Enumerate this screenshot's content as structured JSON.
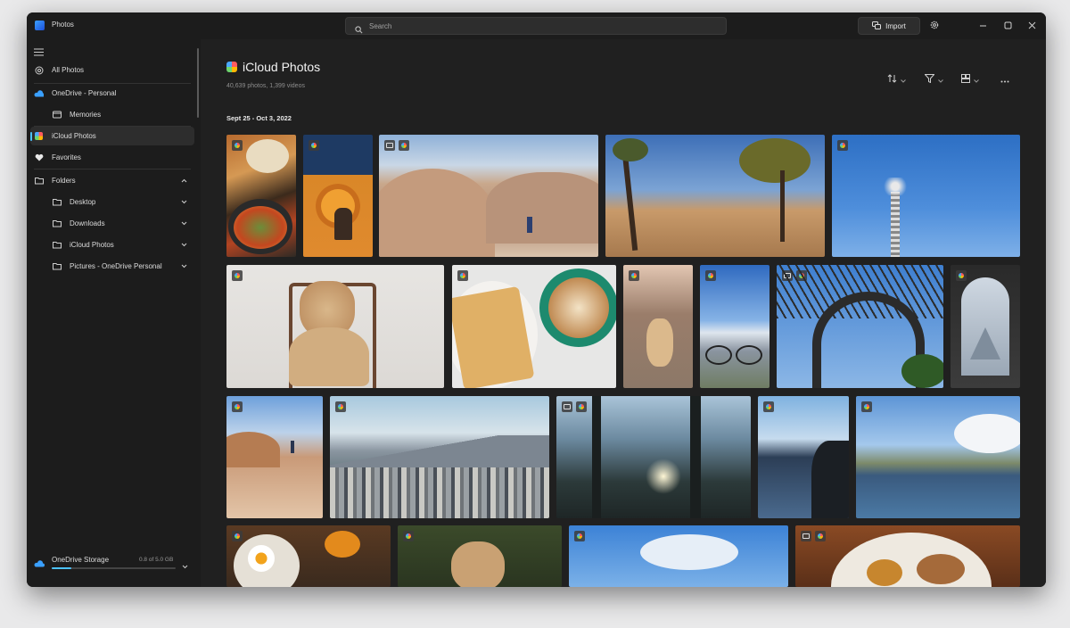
{
  "window": {
    "title": "Photos"
  },
  "search": {
    "placeholder": "Search"
  },
  "toolbar": {
    "import_label": "Import"
  },
  "sidebar": {
    "items": [
      {
        "label": "All Photos",
        "icon": "all-photos-icon"
      },
      {
        "label": "OneDrive - Personal",
        "icon": "onedrive-cloud-icon"
      },
      {
        "label": "Memories",
        "icon": "memories-icon"
      },
      {
        "label": "iCloud Photos",
        "icon": "icloud-photos-icon",
        "selected": true
      },
      {
        "label": "Favorites",
        "icon": "heart-icon"
      },
      {
        "label": "Folders",
        "icon": "folder-icon"
      },
      {
        "label": "Desktop",
        "icon": "folder-icon"
      },
      {
        "label": "Downloads",
        "icon": "folder-icon"
      },
      {
        "label": "iCloud Photos",
        "icon": "folder-icon"
      },
      {
        "label": "Pictures - OneDrive Personal",
        "icon": "folder-icon"
      }
    ],
    "storage": {
      "label": "OneDrive Storage",
      "amount": "0.8 of 5.0 GB",
      "used_fraction": 0.16
    }
  },
  "header": {
    "title": "iCloud Photos",
    "subtitle": "40,639 photos, 1,399 videos"
  },
  "section": {
    "date_range": "Sept 25 - Oct 3, 2022"
  },
  "colors": {
    "accent": "#4cc2ff",
    "background": "#202020",
    "sidebar": "#1c1c1c"
  }
}
